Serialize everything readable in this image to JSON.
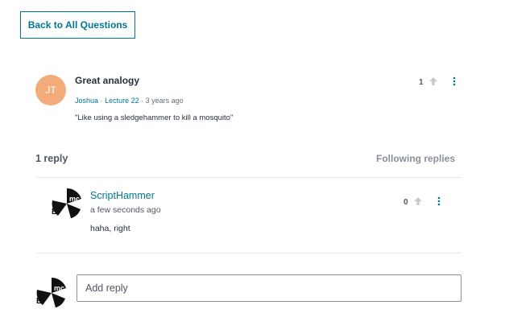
{
  "back_button": {
    "label": "Back to All Questions"
  },
  "question": {
    "avatar_initials": "JT",
    "title": "Great analogy",
    "author": "Joshua",
    "separator": "·",
    "lecture": "Lecture 22",
    "time": "3 years ago",
    "body": "\"Like using a sledgehammer to kill a mosquito\"",
    "votes": "1"
  },
  "replies_header": {
    "count_label": "1 reply",
    "following_label": "Following replies"
  },
  "replies": [
    {
      "author": "ScriptHammer",
      "time": "a few seconds ago",
      "body": "haha, right",
      "votes": "0"
    }
  ],
  "reply_box": {
    "placeholder": "Add reply"
  },
  "colors": {
    "accent": "#007791",
    "initials_avatar_bg": "#f4ab7a",
    "upvote_icon": "#c5c9cf",
    "kebab_icon": "#007791"
  },
  "icons": {
    "upvote": "arrow-up-icon",
    "menu": "kebab-menu-icon",
    "user_avatar": "emc-logo-avatar"
  }
}
